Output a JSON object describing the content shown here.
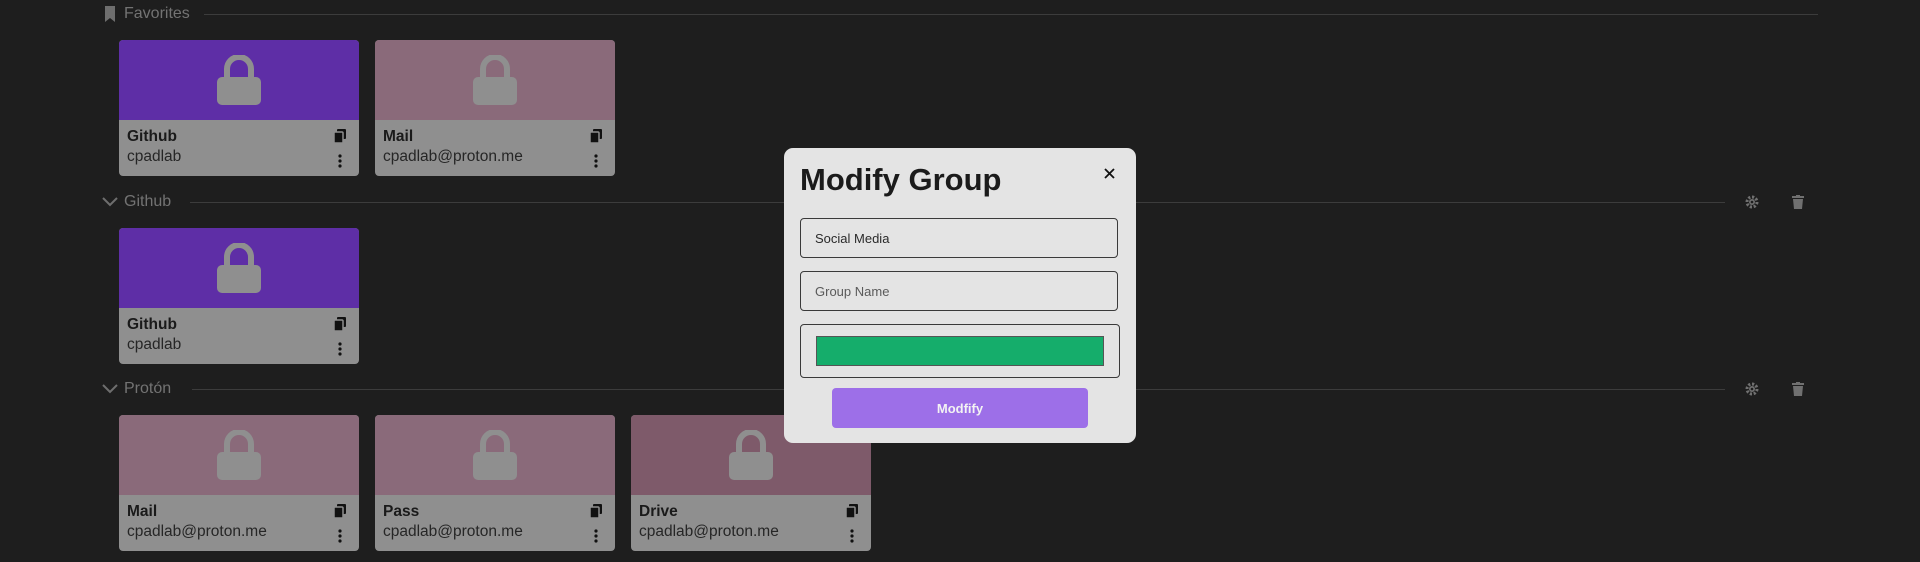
{
  "colors": {
    "github_banner": "#5e2ea6",
    "proton_banner": "#8a6a7a",
    "drive_banner": "#7e5a6a",
    "card_body": "#8f8f8f",
    "modal_bg": "#e4e4e4",
    "swatch": "#15ad6b",
    "button": "#9d6fe8",
    "muted_icon": "#707070"
  },
  "sections": {
    "favorites": {
      "label": "Favorites",
      "icon": "bookmark-icon"
    },
    "github": {
      "label": "Github",
      "icon": "chevron-down-icon"
    },
    "proton": {
      "label": "Protón",
      "icon": "chevron-down-icon"
    }
  },
  "cards": {
    "fav_github": {
      "title": "Github",
      "subtitle": "cpadlab"
    },
    "fav_mail": {
      "title": "Mail",
      "subtitle": "cpadlab@proton.me"
    },
    "github_github": {
      "title": "Github",
      "subtitle": "cpadlab"
    },
    "proton_mail": {
      "title": "Mail",
      "subtitle": "cpadlab@proton.me"
    },
    "proton_pass": {
      "title": "Pass",
      "subtitle": "cpadlab@proton.me"
    },
    "proton_drive": {
      "title": "Drive",
      "subtitle": "cpadlab@proton.me"
    }
  },
  "modal": {
    "title": "Modify Group",
    "close": "×",
    "group_value": "Social Media",
    "group_name_placeholder": "Group Name",
    "button_label": "Modfify"
  }
}
